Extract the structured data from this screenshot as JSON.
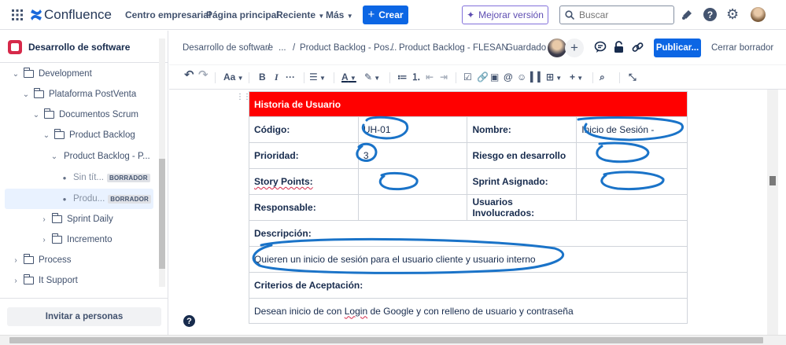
{
  "topnav": {
    "app_name": "Confluence",
    "links": [
      "Centro empresarial",
      "Página principal",
      "Reciente",
      "Más"
    ],
    "create_label": "Crear",
    "upgrade_label": "Mejorar versión",
    "search_placeholder": "Buscar"
  },
  "sidebar": {
    "space_name": "Desarrollo de software",
    "items": [
      {
        "label": "Development"
      },
      {
        "label": "Plataforma PostVenta"
      },
      {
        "label": "Documentos Scrum"
      },
      {
        "label": "Product Backlog"
      },
      {
        "label": "Product Backlog - P..."
      },
      {
        "label": "Sin tít...",
        "badge": "BORRADOR"
      },
      {
        "label": "Produ...",
        "badge": "BORRADOR"
      },
      {
        "label": "Sprint Daily"
      },
      {
        "label": "Incremento"
      },
      {
        "label": "Process"
      },
      {
        "label": "It Support"
      }
    ],
    "invite_label": "Invitar a personas"
  },
  "editor_header": {
    "breadcrumbs": [
      "Desarrollo de software",
      "/",
      "...",
      "/",
      "Product Backlog - Pos...",
      "/",
      "Product Backlog - FLESAN"
    ],
    "status": "Guardado",
    "publish_label": "Publicar...",
    "close_label": "Cerrar borrador"
  },
  "toolbar": {
    "text_style": "Aa",
    "bold": "B",
    "italic": "I",
    "more": "···"
  },
  "story": {
    "header": "Historia de Usuario",
    "rows": [
      {
        "label1": "Código:",
        "value1": "UH-01",
        "label2": "Nombre:",
        "value2": "Inicio de Sesión -"
      },
      {
        "label1": "Prioridad:",
        "value1": "3",
        "label2": "Riesgo en desarrollo",
        "value2": ""
      },
      {
        "label1": "Story Points:",
        "value1": "",
        "label2": "Sprint Asignado:",
        "value2": ""
      },
      {
        "label1": "Responsable:",
        "value1": "",
        "label2": "Usuarios Involucrados:",
        "value2": ""
      }
    ],
    "description_label": "Descripción:",
    "description_text": "Quieren un inicio de sesión para el usuario cliente y usuario interno",
    "criteria_label": "Criterios de Aceptación:",
    "criteria_text_1": "Desean inicio de con ",
    "criteria_text_login": "Login",
    "criteria_text_2": " de Google y con relleno de usuario y contraseña"
  },
  "colors": {
    "accent": "#0c66e4",
    "header_red": "#ff0000",
    "ink_blue": "#1a73c8"
  }
}
